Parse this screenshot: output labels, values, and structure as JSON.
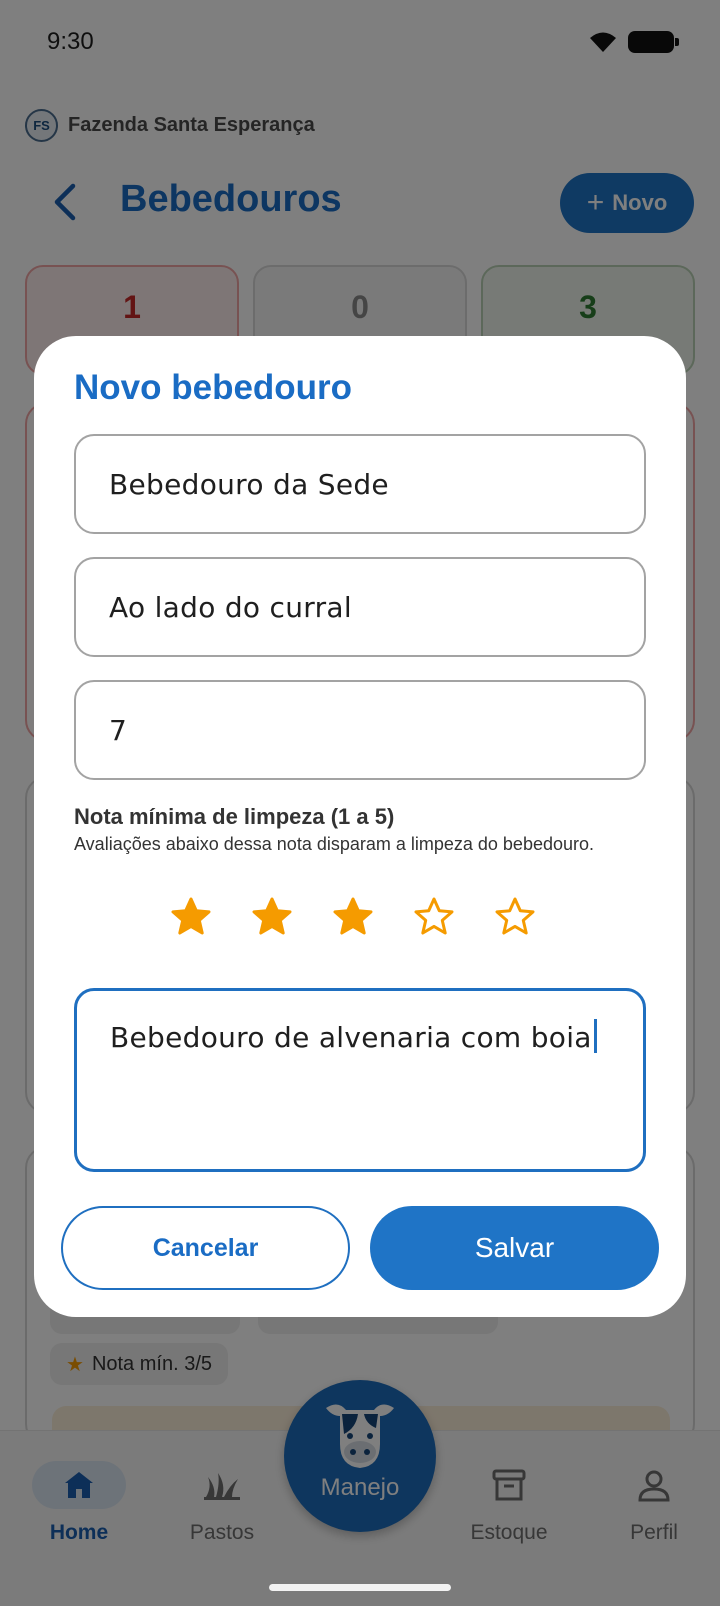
{
  "status_bar": {
    "time": "9:30"
  },
  "farm": {
    "initials": "FS",
    "name": "Fazenda Santa Esperança"
  },
  "header": {
    "title": "Bebedouros",
    "new_label": "Novo"
  },
  "summary": {
    "critical": "1",
    "pending": "0",
    "ok": "3"
  },
  "background_card": {
    "min_rating_chip": "Nota mín. 3/5"
  },
  "dialog": {
    "title": "Novo bebedouro",
    "name_value": "Bebedouro da Sede",
    "location_value": "Ao lado do curral",
    "capacity_value": "7",
    "rating_title": "Nota mínima de limpeza (1 a 5)",
    "rating_help": "Avaliações abaixo dessa nota disparam a limpeza do bebedouro.",
    "rating_value": 3,
    "rating_max": 5,
    "notes_value": "Bebedouro de alvenaria com boia",
    "cancel_label": "Cancelar",
    "save_label": "Salvar"
  },
  "bottom_nav": {
    "home": "Home",
    "pastos": "Pastos",
    "manejo": "Manejo",
    "estoque": "Estoque",
    "perfil": "Perfil"
  },
  "colors": {
    "primary": "#1f74c6",
    "title_blue": "#1a6cc4",
    "star": "#f59b00",
    "critical": "#c62828",
    "ok": "#2e7d32"
  }
}
